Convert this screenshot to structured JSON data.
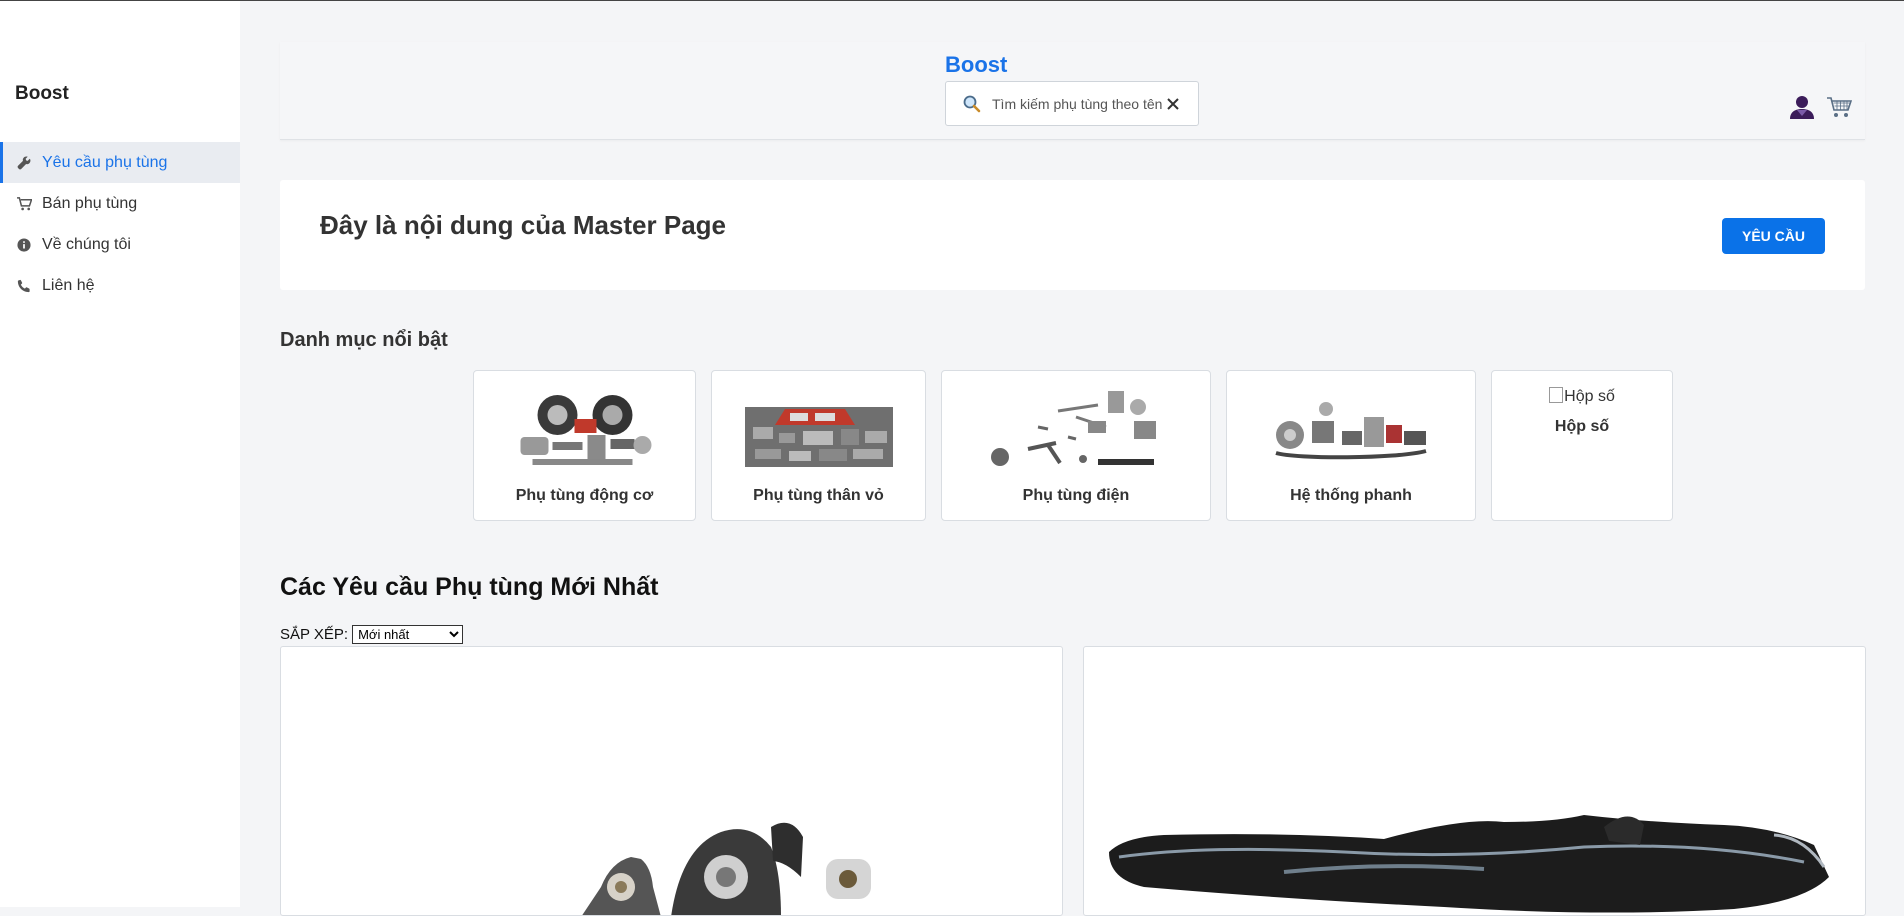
{
  "sidebar": {
    "brand": "Boost",
    "items": [
      {
        "label": "Yêu cầu phụ tùng",
        "icon": "wrench-icon",
        "active": true
      },
      {
        "label": "Bán phụ tùng",
        "icon": "cart-icon",
        "active": false
      },
      {
        "label": "Về chúng tôi",
        "icon": "info-icon",
        "active": false
      },
      {
        "label": "Liên hệ",
        "icon": "phone-icon",
        "active": false
      }
    ]
  },
  "header": {
    "title": "Boost",
    "search_placeholder": "Tìm kiếm phụ tùng theo tên",
    "icons": [
      "search-icon",
      "clear-icon",
      "user-icon",
      "shopping-cart-icon"
    ]
  },
  "hero": {
    "title": "Đây là nội dung của Master Page",
    "button_label": "YÊU CẦU"
  },
  "categories": {
    "title": "Danh mục nổi bật",
    "items": [
      {
        "label": "Phụ tùng động cơ"
      },
      {
        "label": "Phụ tùng thân vỏ"
      },
      {
        "label": "Phụ tùng điện"
      },
      {
        "label": "Hệ thống phanh"
      },
      {
        "label": "Hộp số",
        "image_alt": "Hộp số"
      }
    ]
  },
  "latest": {
    "title": "Các Yêu cầu Phụ tùng Mới Nhất",
    "sort_label": "SẮP XẾP:",
    "sort_selected": "Mới nhất"
  },
  "colors": {
    "accent": "#1a73e8",
    "button": "#0a72e8",
    "background": "#f4f5f7"
  }
}
